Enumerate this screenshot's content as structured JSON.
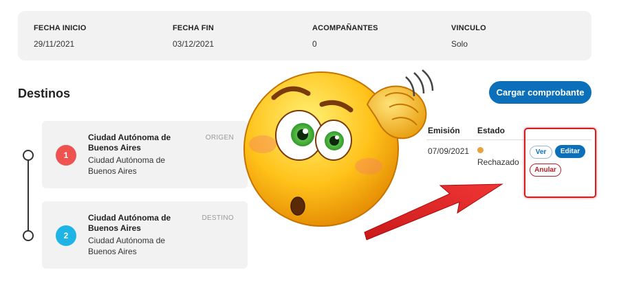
{
  "trip": {
    "fields": [
      {
        "label": "FECHA INICIO",
        "value": "29/11/2021"
      },
      {
        "label": "FECHA FIN",
        "value": "03/12/2021"
      },
      {
        "label": "ACOMPAÑANTES",
        "value": "0"
      },
      {
        "label": "VINCULO",
        "value": "Solo"
      }
    ]
  },
  "destinations": {
    "title": "Destinos",
    "upload_button": "Cargar comprobante",
    "items": [
      {
        "number": "1",
        "name": "Ciudad Autónoma de Buenos Aires",
        "sub": "Ciudad Autónoma de Buenos Aires",
        "tag": "ORIGEN",
        "color": "#ef5350"
      },
      {
        "number": "2",
        "name": "Ciudad Autónoma de Buenos Aires",
        "sub": "Ciudad Autónoma de Buenos Aires",
        "tag": "DESTINO",
        "color": "#1eb4e6"
      }
    ]
  },
  "table": {
    "headers": {
      "emission": "Emisión",
      "status": "Estado"
    },
    "row": {
      "emission": "07/09/2021",
      "status": "Rechazado",
      "status_color": "#e8a43c"
    },
    "actions": {
      "view": "Ver",
      "edit": "Editar",
      "cancel": "Anular"
    }
  },
  "colors": {
    "accent": "#0c6fb9",
    "highlight_frame": "#d21e1e",
    "arrow": "#e01b1b"
  },
  "overlay": {
    "emoji": "confused-thinking-emoji",
    "arrow": "red-arrow"
  }
}
